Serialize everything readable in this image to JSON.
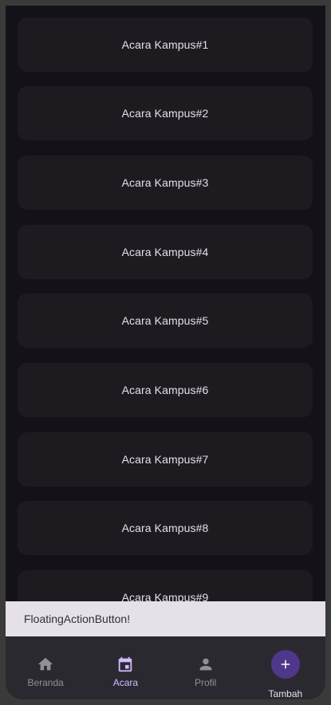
{
  "events": [
    {
      "title": "Acara Kampus#1"
    },
    {
      "title": "Acara Kampus#2"
    },
    {
      "title": "Acara Kampus#3"
    },
    {
      "title": "Acara Kampus#4"
    },
    {
      "title": "Acara Kampus#5"
    },
    {
      "title": "Acara Kampus#6"
    },
    {
      "title": "Acara Kampus#7"
    },
    {
      "title": "Acara Kampus#8"
    },
    {
      "title": "Acara Kampus#9"
    }
  ],
  "snackbar": {
    "message": "FloatingActionButton!"
  },
  "nav": {
    "items": [
      {
        "label": "Beranda",
        "icon": "home-icon",
        "active": false
      },
      {
        "label": "Acara",
        "icon": "calendar-icon",
        "active": true
      },
      {
        "label": "Profil",
        "icon": "person-icon",
        "active": false
      },
      {
        "label": "Tambah",
        "icon": "add-icon",
        "active": false
      }
    ]
  },
  "colors": {
    "background": "#141218",
    "card": "#1d1b20",
    "accent": "#d0bcff",
    "fab": "#4f378b",
    "snackbar": "#e6e0e9"
  }
}
